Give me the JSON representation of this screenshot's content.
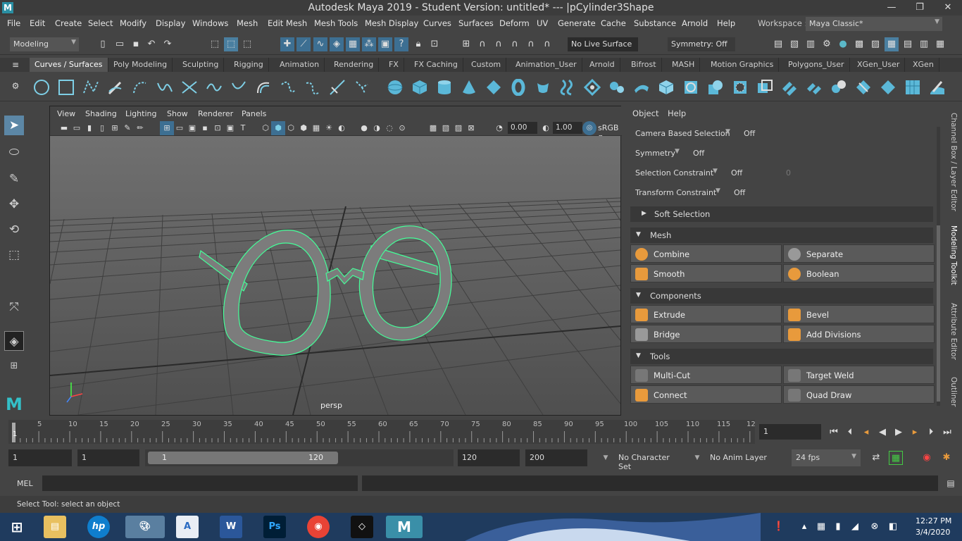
{
  "window": {
    "title": "Autodesk Maya 2019 - Student Version: untitled*    ---    |pCylinder3Shape",
    "logo": "M",
    "controls": [
      "—",
      "❐",
      "✕"
    ]
  },
  "menubar": [
    "File",
    "Edit",
    "Create",
    "Select",
    "Modify",
    "Display",
    "Windows",
    "Mesh",
    "Edit Mesh",
    "Mesh Tools",
    "Mesh Display",
    "Curves",
    "Surfaces",
    "Deform",
    "UV",
    "Generate",
    "Cache",
    "Substance",
    "Arnold",
    "Help"
  ],
  "workspace": {
    "label": "Workspace :",
    "value": "Maya Classic*"
  },
  "statusline": {
    "mode": "Modeling",
    "live_surface": "No Live Surface",
    "symmetry": "Symmetry: Off"
  },
  "shelf_tabs": [
    "Curves / Surfaces",
    "Poly Modeling",
    "Sculpting",
    "Rigging",
    "Animation",
    "Rendering",
    "FX",
    "FX Caching",
    "Custom",
    "Animation_User",
    "Arnold",
    "Bifrost",
    "MASH",
    "Motion Graphics",
    "Polygons_User",
    "XGen_User",
    "XGen"
  ],
  "shelf_active": "Curves / Surfaces",
  "viewport": {
    "menu": [
      "View",
      "Shading",
      "Lighting",
      "Show",
      "Renderer",
      "Panels"
    ],
    "exposure": "0.00",
    "gamma": "1.00",
    "colorspace": "sRGB g",
    "camera_label": "persp"
  },
  "modeling_toolkit": {
    "menu": [
      "Object",
      "Help"
    ],
    "rows": [
      {
        "label": "Camera Based Selection",
        "value": "Off"
      },
      {
        "label": "Symmetry",
        "value": "Off"
      },
      {
        "label": "Selection Constraint",
        "value": "Off",
        "extra": "0"
      },
      {
        "label": "Transform Constraint",
        "value": "Off"
      }
    ],
    "soft_selection": "Soft Selection",
    "sections": [
      {
        "title": "Mesh",
        "buttons": [
          "Combine",
          "Separate",
          "Smooth",
          "Boolean"
        ]
      },
      {
        "title": "Components",
        "buttons": [
          "Extrude",
          "Bevel",
          "Bridge",
          "Add Divisions"
        ]
      },
      {
        "title": "Tools",
        "buttons": [
          "Multi-Cut",
          "Target Weld",
          "Connect",
          "Quad Draw"
        ]
      }
    ]
  },
  "side_tabs": [
    "Channel Box / Layer Editor",
    "Modeling Toolkit",
    "Attribute Editor",
    "Outliner"
  ],
  "timeline": {
    "ticks": [
      "1",
      "5",
      "10",
      "15",
      "20",
      "25",
      "30",
      "35",
      "40",
      "45",
      "50",
      "55",
      "60",
      "65",
      "70",
      "75",
      "80",
      "85",
      "90",
      "95",
      "100",
      "105",
      "110",
      "115",
      "12"
    ],
    "current_frame": "1"
  },
  "range": {
    "start": "1",
    "inner_start": "1",
    "slider_start": "1",
    "slider_end": "120",
    "end": "120",
    "anim_end": "200",
    "character_set": "No Character Set",
    "anim_layer": "No Anim Layer",
    "fps": "24 fps"
  },
  "cmdline": {
    "label": "MEL"
  },
  "helpline": {
    "text": "Select Tool: select an object"
  },
  "taskbar": {
    "time": "12:27 PM",
    "date": "3/4/2020"
  }
}
